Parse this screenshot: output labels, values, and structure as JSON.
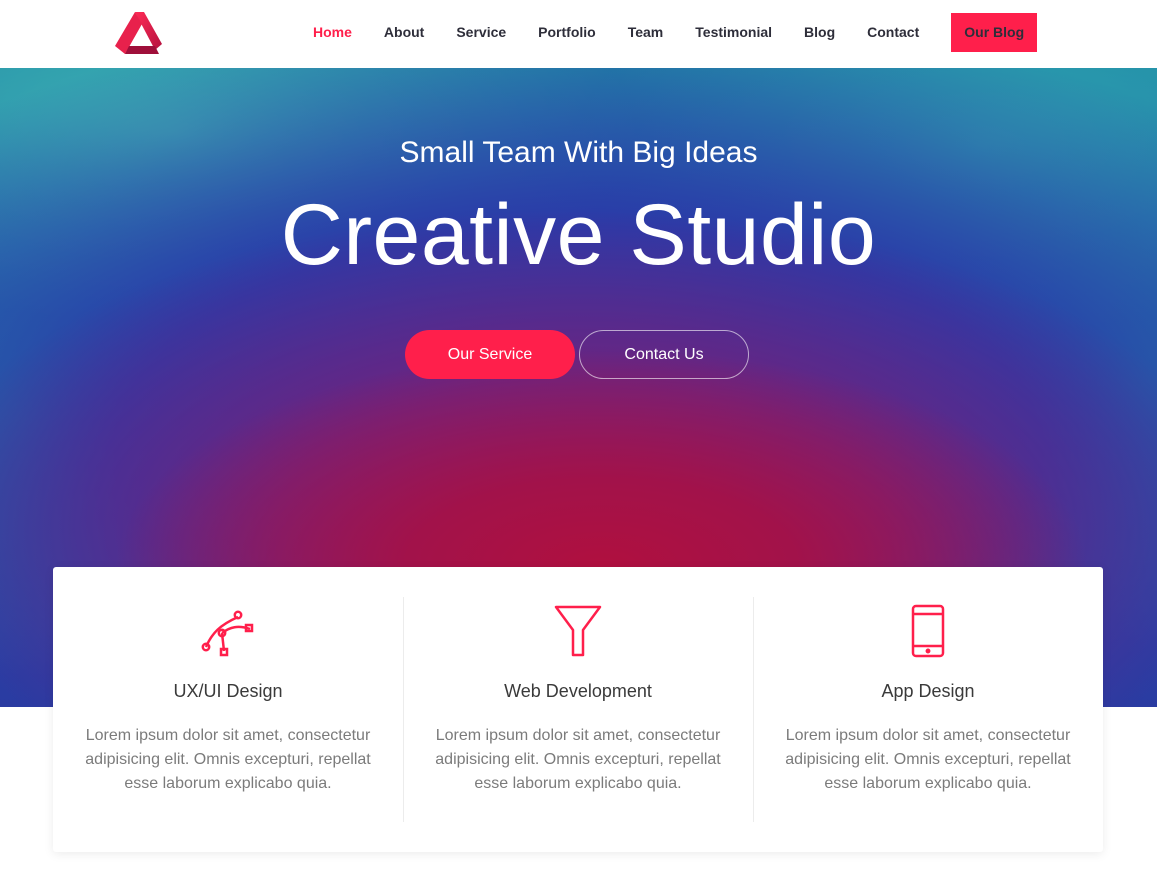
{
  "brand": {
    "accent": "#ff1f4b",
    "logo_icon": "triangle-logo-icon"
  },
  "nav": {
    "items": [
      {
        "label": "Home",
        "active": true
      },
      {
        "label": "About",
        "active": false
      },
      {
        "label": "Service",
        "active": false
      },
      {
        "label": "Portfolio",
        "active": false
      },
      {
        "label": "Team",
        "active": false
      },
      {
        "label": "Testimonial",
        "active": false
      },
      {
        "label": "Blog",
        "active": false
      },
      {
        "label": "Contact",
        "active": false
      }
    ],
    "cta_label": "Our Blog"
  },
  "hero": {
    "subtitle": "Small Team With Big Ideas",
    "title": "Creative Studio",
    "primary_button": "Our Service",
    "secondary_button": "Contact Us"
  },
  "services": [
    {
      "icon": "vector-pen-icon",
      "title": "UX/UI Design",
      "text": "Lorem ipsum dolor sit amet, consectetur adipisicing elit. Omnis excepturi, repellat esse laborum explicabo quia."
    },
    {
      "icon": "funnel-icon",
      "title": "Web Development",
      "text": "Lorem ipsum dolor sit amet, consectetur adipisicing elit. Omnis excepturi, repellat esse laborum explicabo quia."
    },
    {
      "icon": "tablet-icon",
      "title": "App Design",
      "text": "Lorem ipsum dolor sit amet, consectetur adipisicing elit. Omnis excepturi, repellat esse laborum explicabo quia."
    }
  ]
}
